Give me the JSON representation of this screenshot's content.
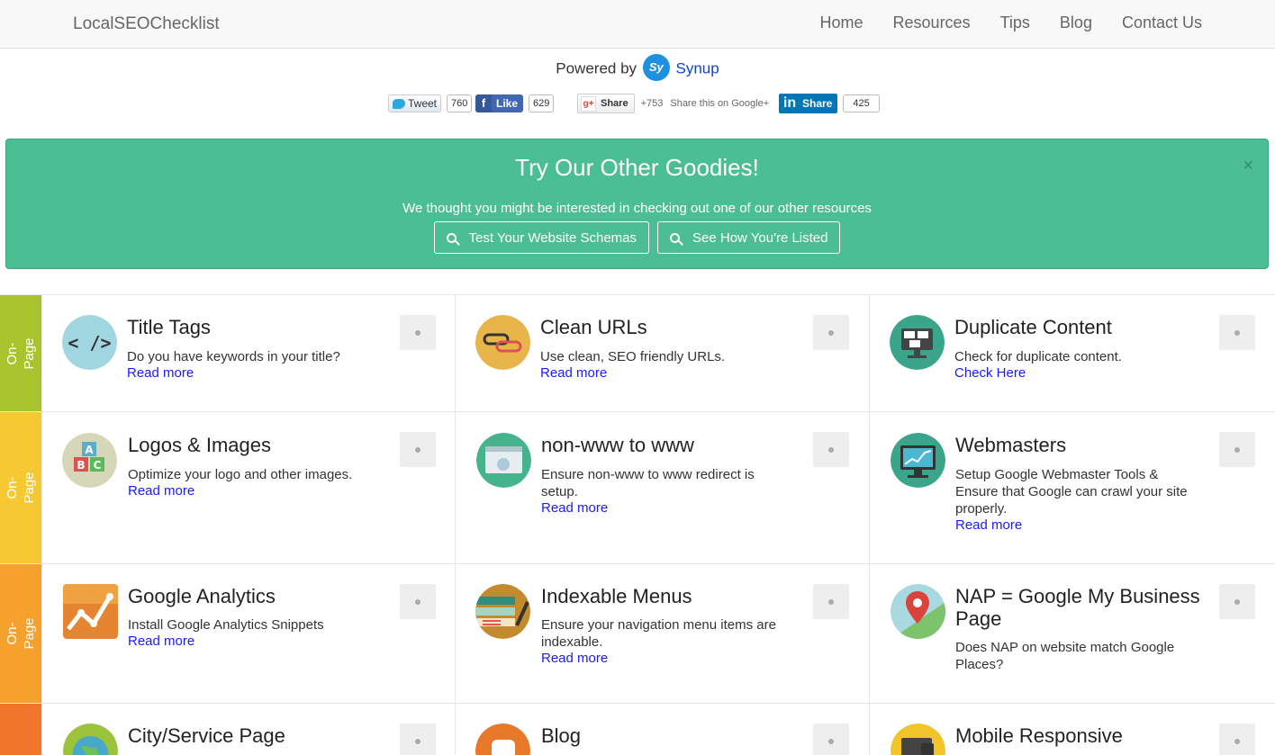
{
  "nav": {
    "brand": "LocalSEOChecklist",
    "links": [
      "Home",
      "Resources",
      "Tips",
      "Blog",
      "Contact Us"
    ]
  },
  "powered": {
    "label": "Powered by",
    "logo_text": "Sy",
    "link": "Synup"
  },
  "social": {
    "tweet_label": "Tweet",
    "tweet_count": "760",
    "like_label": "Like",
    "like_count": "629",
    "gplus_label": "Share",
    "gplus_count": "+753",
    "gplus_text": "Share this on Google+",
    "linkedin_label": "Share",
    "linkedin_count": "425"
  },
  "banner": {
    "title": "Try Our Other Goodies!",
    "close": "×",
    "subtitle": "We thought you might be interested in checking out one of our other resources",
    "btn1": "Test Your Website Schemas",
    "btn2": "See How You're Listed",
    "bg_color": "#4cbe93"
  },
  "rows": [
    {
      "side_label_1": "On-",
      "side_label_2": "Page",
      "side_color": "#a8c42c",
      "cells": [
        {
          "title": "Title Tags",
          "desc": "Do you have keywords in your title?",
          "link": "Read more",
          "icon": "code-icon"
        },
        {
          "title": "Clean URLs",
          "desc": "Use clean, SEO friendly URLs.",
          "link": "Read more",
          "icon": "chain-link-icon"
        },
        {
          "title": "Duplicate Content",
          "desc": "Check for duplicate content.",
          "link": "Check Here",
          "icon": "monitor-duplicate-icon"
        }
      ]
    },
    {
      "side_label_1": "On-",
      "side_label_2": "Page",
      "side_color": "#f6c832",
      "cells": [
        {
          "title": "Logos & Images",
          "desc": "Optimize your logo and other images.",
          "link": "Read more",
          "icon": "abc-blocks-icon"
        },
        {
          "title": "non-www to www",
          "desc": "Ensure non-www to www redirect is setup.",
          "link": "Read more",
          "icon": "browser-gear-icon"
        },
        {
          "title": "Webmasters",
          "desc": "Setup Google Webmaster Tools & Ensure that Google can crawl your site properly.",
          "link": "Read more",
          "icon": "monitor-chart-icon"
        }
      ]
    },
    {
      "side_label_1": "On-",
      "side_label_2": "Page",
      "side_color": "#f6a12e",
      "cells": [
        {
          "title": "Google Analytics",
          "desc": "Install Google Analytics Snippets",
          "link": "Read more",
          "icon": "analytics-chart-icon"
        },
        {
          "title": "Indexable Menus",
          "desc": "Ensure your navigation menu items are indexable.",
          "link": "Read more",
          "icon": "menu-pen-icon"
        },
        {
          "title": "NAP = Google My Business Page",
          "desc": "Does NAP on website match Google Places?",
          "link": "",
          "icon": "map-pin-icon"
        }
      ]
    },
    {
      "side_label_1": "",
      "side_label_2": "",
      "side_color": "#f2762a",
      "cells": [
        {
          "title": "City/Service Page",
          "desc": "",
          "link": "",
          "icon": "globe-icon"
        },
        {
          "title": "Blog",
          "desc": "",
          "link": "",
          "icon": "blogger-icon"
        },
        {
          "title": "Mobile Responsive",
          "desc": "",
          "link": "",
          "icon": "devices-icon"
        }
      ]
    }
  ]
}
